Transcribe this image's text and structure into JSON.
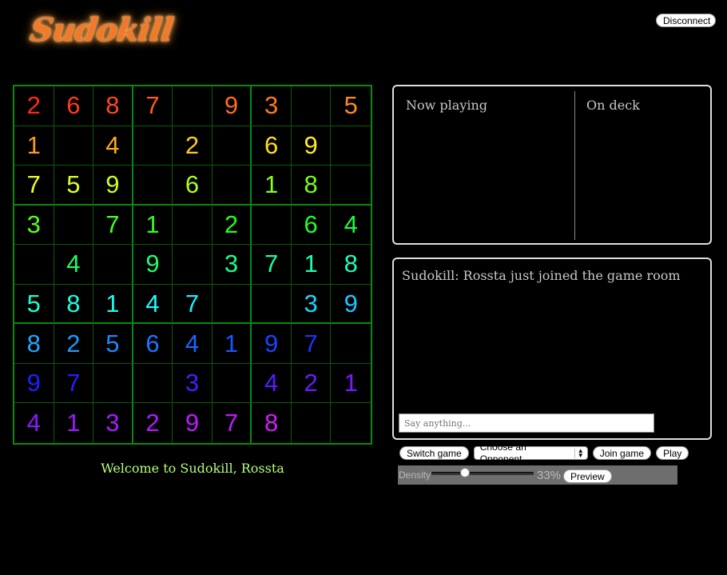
{
  "header": {
    "logo_text": "Sudokill",
    "disconnect_label": "Disconnect"
  },
  "board": {
    "grid": [
      [
        "2",
        "6",
        "8",
        "7",
        "",
        "9",
        "3",
        "",
        "5"
      ],
      [
        "1",
        "",
        "4",
        "",
        "2",
        "",
        "6",
        "9",
        ""
      ],
      [
        "7",
        "5",
        "9",
        "",
        "6",
        "",
        "1",
        "8",
        ""
      ],
      [
        "3",
        "",
        "7",
        "1",
        "",
        "2",
        "",
        "6",
        "4"
      ],
      [
        "",
        "4",
        "",
        "9",
        "",
        "3",
        "7",
        "1",
        "8"
      ],
      [
        "5",
        "8",
        "1",
        "4",
        "7",
        "",
        "",
        "3",
        "9"
      ],
      [
        "8",
        "2",
        "5",
        "6",
        "4",
        "1",
        "9",
        "7",
        ""
      ],
      [
        "9",
        "7",
        "",
        "",
        "3",
        "",
        "4",
        "2",
        "1"
      ],
      [
        "4",
        "1",
        "3",
        "2",
        "9",
        "7",
        "8",
        "",
        ""
      ]
    ],
    "colors": [
      [
        "#ff2a1a",
        "#ff3a1a",
        "#ff4a1a",
        "#ff5a1a",
        "",
        "#ff6a1a",
        "#ff7a1a",
        "",
        "#ff8a1a"
      ],
      [
        "#ff9a1a",
        "",
        "#ffaa1a",
        "",
        "#ffcc1a",
        "",
        "#ffdd1a",
        "#ffee1a",
        ""
      ],
      [
        "#eeff1a",
        "#ddff1a",
        "#ccff1a",
        "",
        "#aaff1a",
        "",
        "#88ff1a",
        "#77ff1a",
        ""
      ],
      [
        "#55ff1a",
        "",
        "#44ff1a",
        "#33ff1a",
        "",
        "#22ff1a",
        "",
        "#1aff2a",
        "#1aff3a"
      ],
      [
        "",
        "#1aff5a",
        "",
        "#1aff6a",
        "",
        "#1aff8a",
        "#1aff9a",
        "#1affaa",
        "#1affbb"
      ],
      [
        "#1affcc",
        "#1affdd",
        "#1affee",
        "#1affff",
        "#1aeeff",
        "",
        "",
        "#1ad6ff",
        "#1ac6ff"
      ],
      [
        "#1aaaff",
        "#1a99ff",
        "#1a88ff",
        "#1a77ff",
        "#1a66ff",
        "#1a55ff",
        "#1a44ff",
        "#1a33ff",
        ""
      ],
      [
        "#1a22ff",
        "#2a1aff",
        "",
        "",
        "#4a1aff",
        "",
        "#5a1aff",
        "#6a1aff",
        "#7a1aff"
      ],
      [
        "#8a1aff",
        "#9a1aff",
        "#aa1aff",
        "#b21aff",
        "#bb1aff",
        "#c41aff",
        "#d41aff",
        "",
        ""
      ]
    ]
  },
  "welcome_text": "Welcome to Sudokill, Rossta",
  "players_panel": {
    "now_playing_label": "Now playing",
    "on_deck_label": "On deck"
  },
  "chat": {
    "messages": [
      "Sudokill: Rossta just joined the game room"
    ],
    "input_placeholder": "Say anything..."
  },
  "controls": {
    "switch_game_label": "Switch game",
    "opponent_select_value": "Choose an Opponent",
    "join_game_label": "Join game",
    "play_label": "Play"
  },
  "density": {
    "label": "Density",
    "value": 33,
    "value_text": "33%",
    "preview_label": "Preview"
  }
}
